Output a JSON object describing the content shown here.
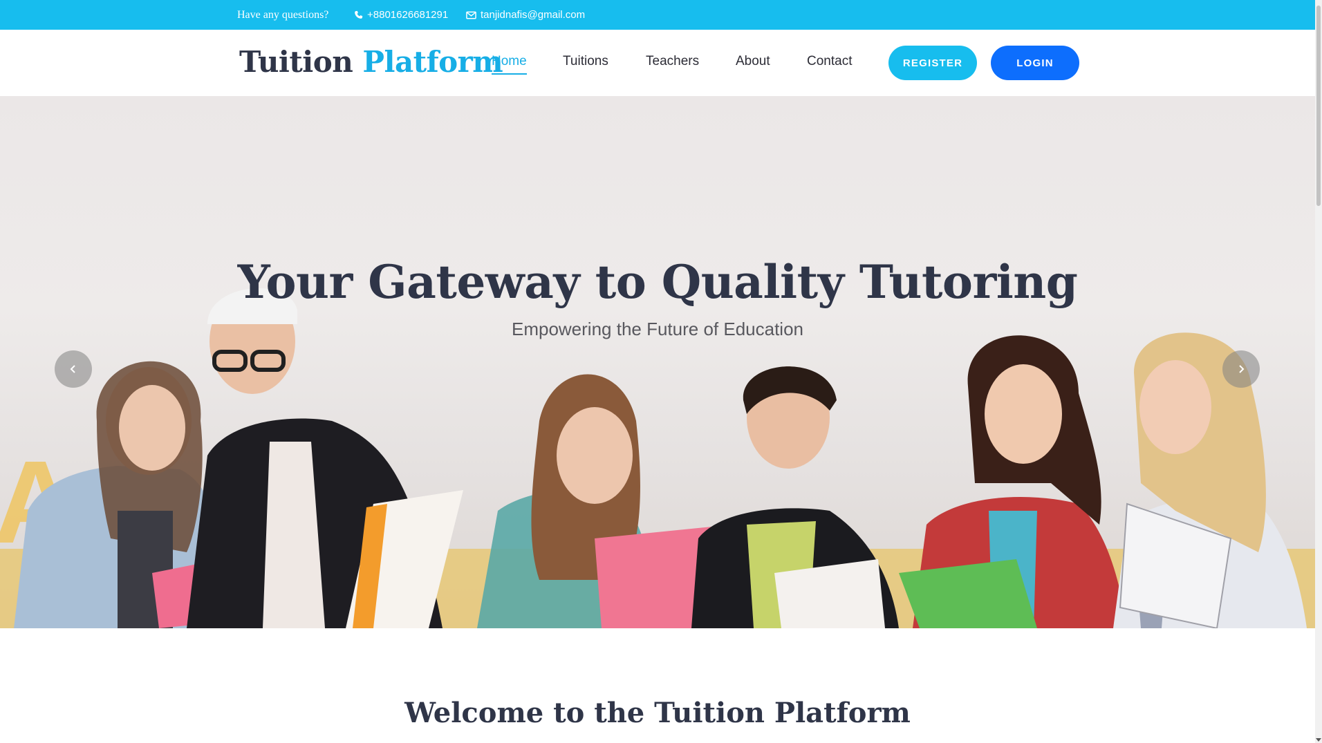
{
  "topbar": {
    "question": "Have any questions?",
    "phone": "+8801626681291",
    "email": "tanjidnafis@gmail.com"
  },
  "header": {
    "logo_part1": "Tuition",
    "logo_part2": "Platform",
    "nav": [
      {
        "label": "Home",
        "active": true
      },
      {
        "label": "Tuitions",
        "active": false
      },
      {
        "label": "Teachers",
        "active": false
      },
      {
        "label": "About",
        "active": false
      },
      {
        "label": "Contact",
        "active": false
      }
    ],
    "register_label": "REGISTER",
    "login_label": "LOGIN"
  },
  "hero": {
    "title": "Your Gateway to Quality Tutoring",
    "subtitle": "Empowering the Future of Education",
    "prev_icon": "chevron-left-icon",
    "next_icon": "chevron-right-icon"
  },
  "welcome": {
    "title": "Welcome to the Tuition Platform"
  },
  "colors": {
    "accent": "#17bdee",
    "login": "#0d6efd",
    "heading": "#2f3548"
  }
}
